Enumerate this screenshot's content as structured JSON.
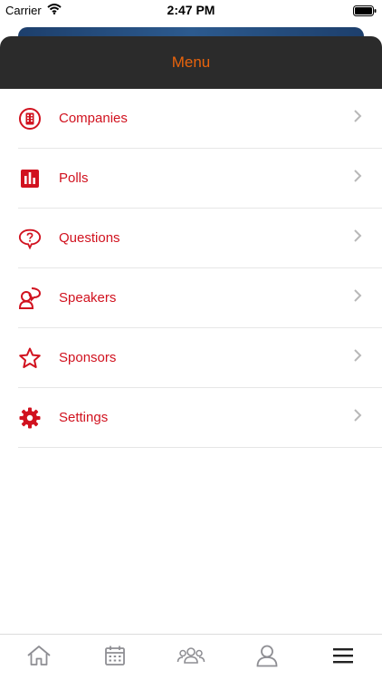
{
  "status": {
    "carrier": "Carrier",
    "time": "2:47 PM"
  },
  "header": {
    "title": "Menu"
  },
  "menu": {
    "items": [
      {
        "label": "Companies",
        "icon": "building-icon"
      },
      {
        "label": "Polls",
        "icon": "bar-chart-icon"
      },
      {
        "label": "Questions",
        "icon": "question-bubble-icon"
      },
      {
        "label": "Speakers",
        "icon": "speaker-icon"
      },
      {
        "label": "Sponsors",
        "icon": "star-icon"
      },
      {
        "label": "Settings",
        "icon": "gear-icon"
      }
    ]
  },
  "tabbar": {
    "tabs": [
      {
        "icon": "home-icon"
      },
      {
        "icon": "calendar-icon"
      },
      {
        "icon": "people-icon"
      },
      {
        "icon": "profile-icon"
      },
      {
        "icon": "hamburger-menu-icon"
      }
    ]
  },
  "colors": {
    "accent": "#d1121f",
    "header_title": "#e8630c",
    "header_bg": "#2b2b2b",
    "chevron": "#b8b8b8"
  }
}
